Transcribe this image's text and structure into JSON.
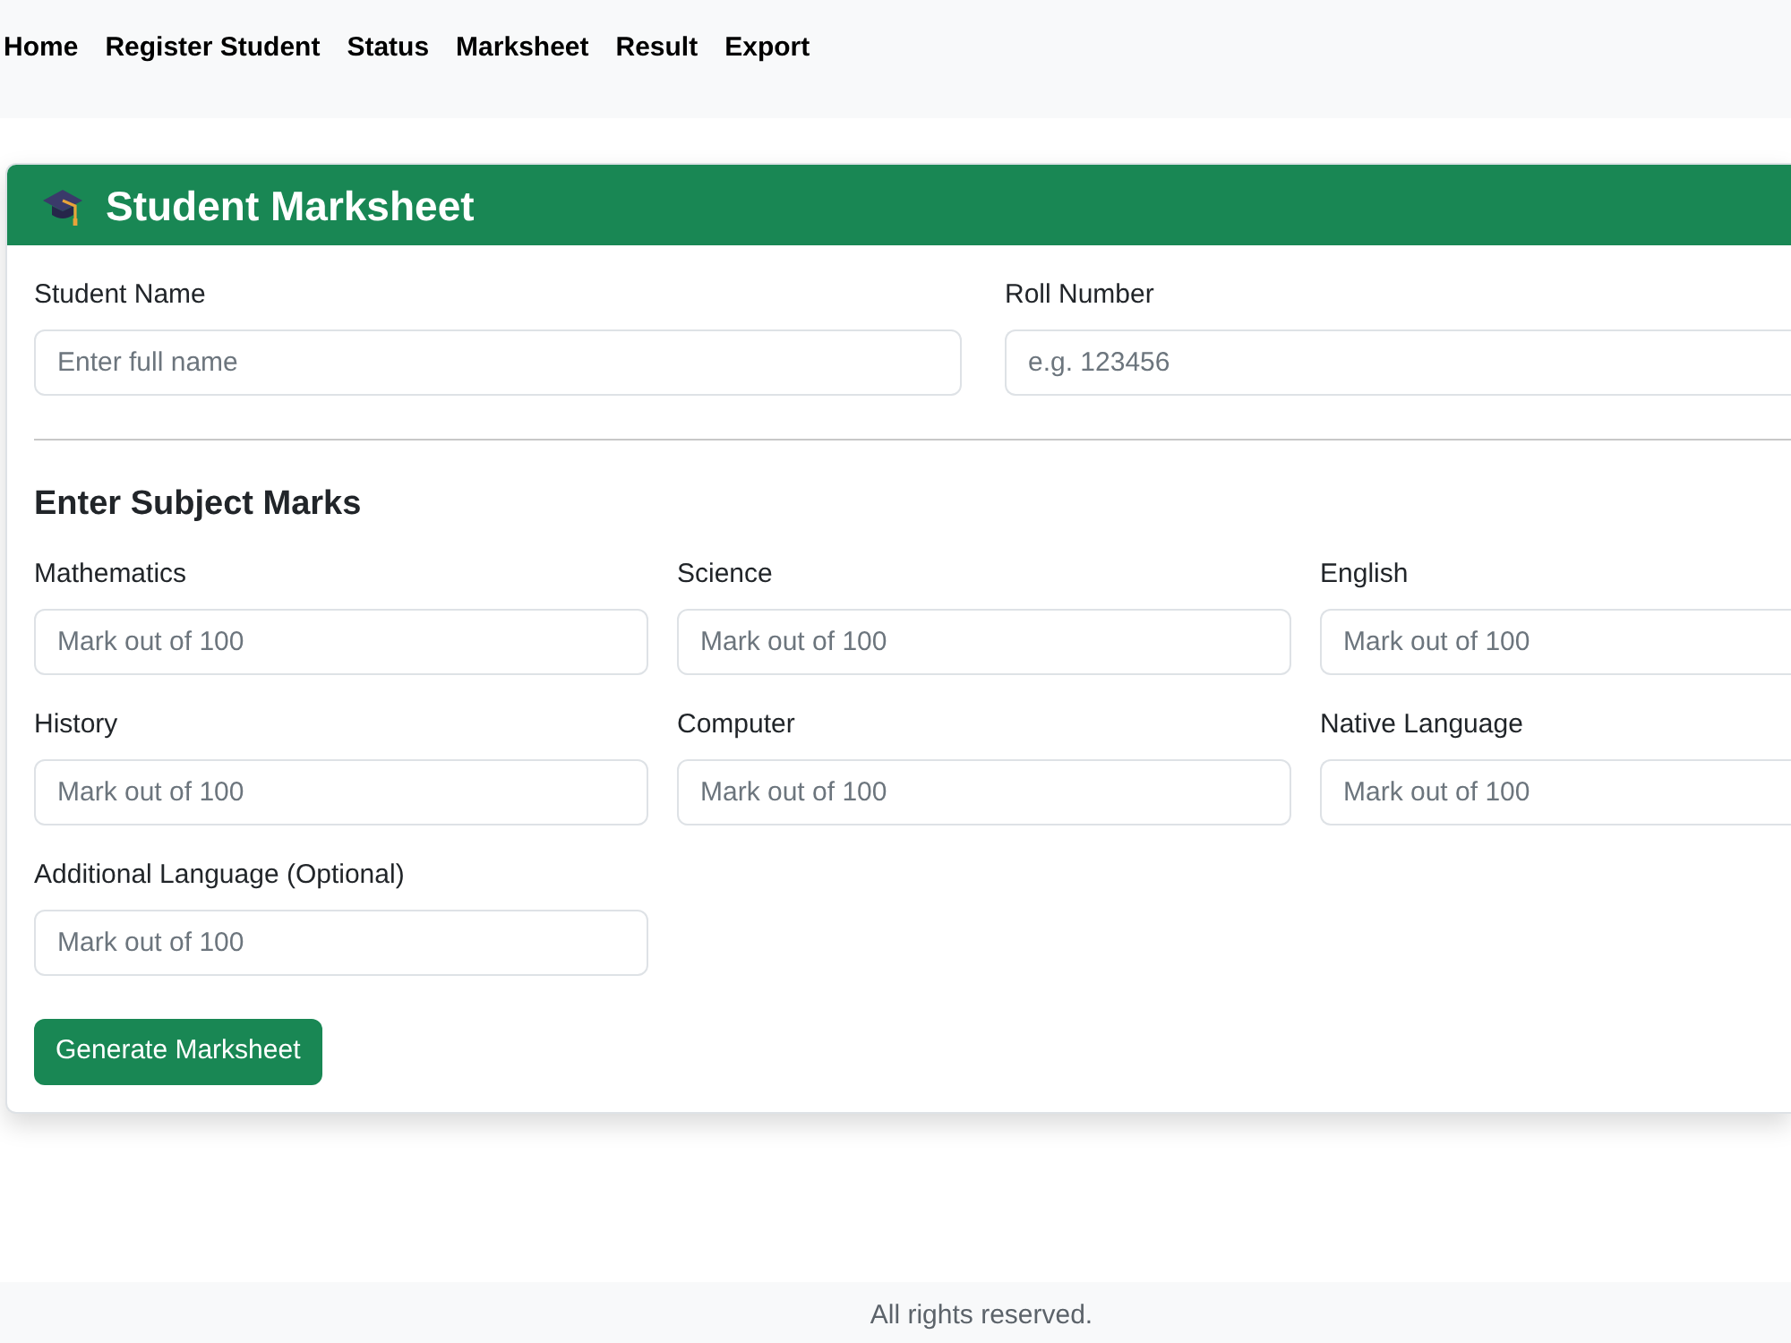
{
  "nav": {
    "links": [
      "Home",
      "Register Student",
      "Status",
      "Marksheet",
      "Result",
      "Export"
    ]
  },
  "card": {
    "title": "Student Marksheet",
    "student_fields": [
      {
        "label": "Student Name",
        "placeholder": "Enter full name"
      },
      {
        "label": "Roll Number",
        "placeholder": "e.g. 123456"
      }
    ],
    "section_title": "Enter Subject Marks",
    "subject_fields": [
      {
        "label": "Mathematics",
        "placeholder": "Mark out of 100"
      },
      {
        "label": "Science",
        "placeholder": "Mark out of 100"
      },
      {
        "label": "English",
        "placeholder": "Mark out of 100"
      },
      {
        "label": "History",
        "placeholder": "Mark out of 100"
      },
      {
        "label": "Computer",
        "placeholder": "Mark out of 100"
      },
      {
        "label": "Native Language",
        "placeholder": "Mark out of 100"
      },
      {
        "label": "Additional Language (Optional)",
        "placeholder": "Mark out of 100"
      }
    ],
    "submit_button": "Generate Marksheet"
  },
  "footer": {
    "text": "All rights reserved."
  }
}
